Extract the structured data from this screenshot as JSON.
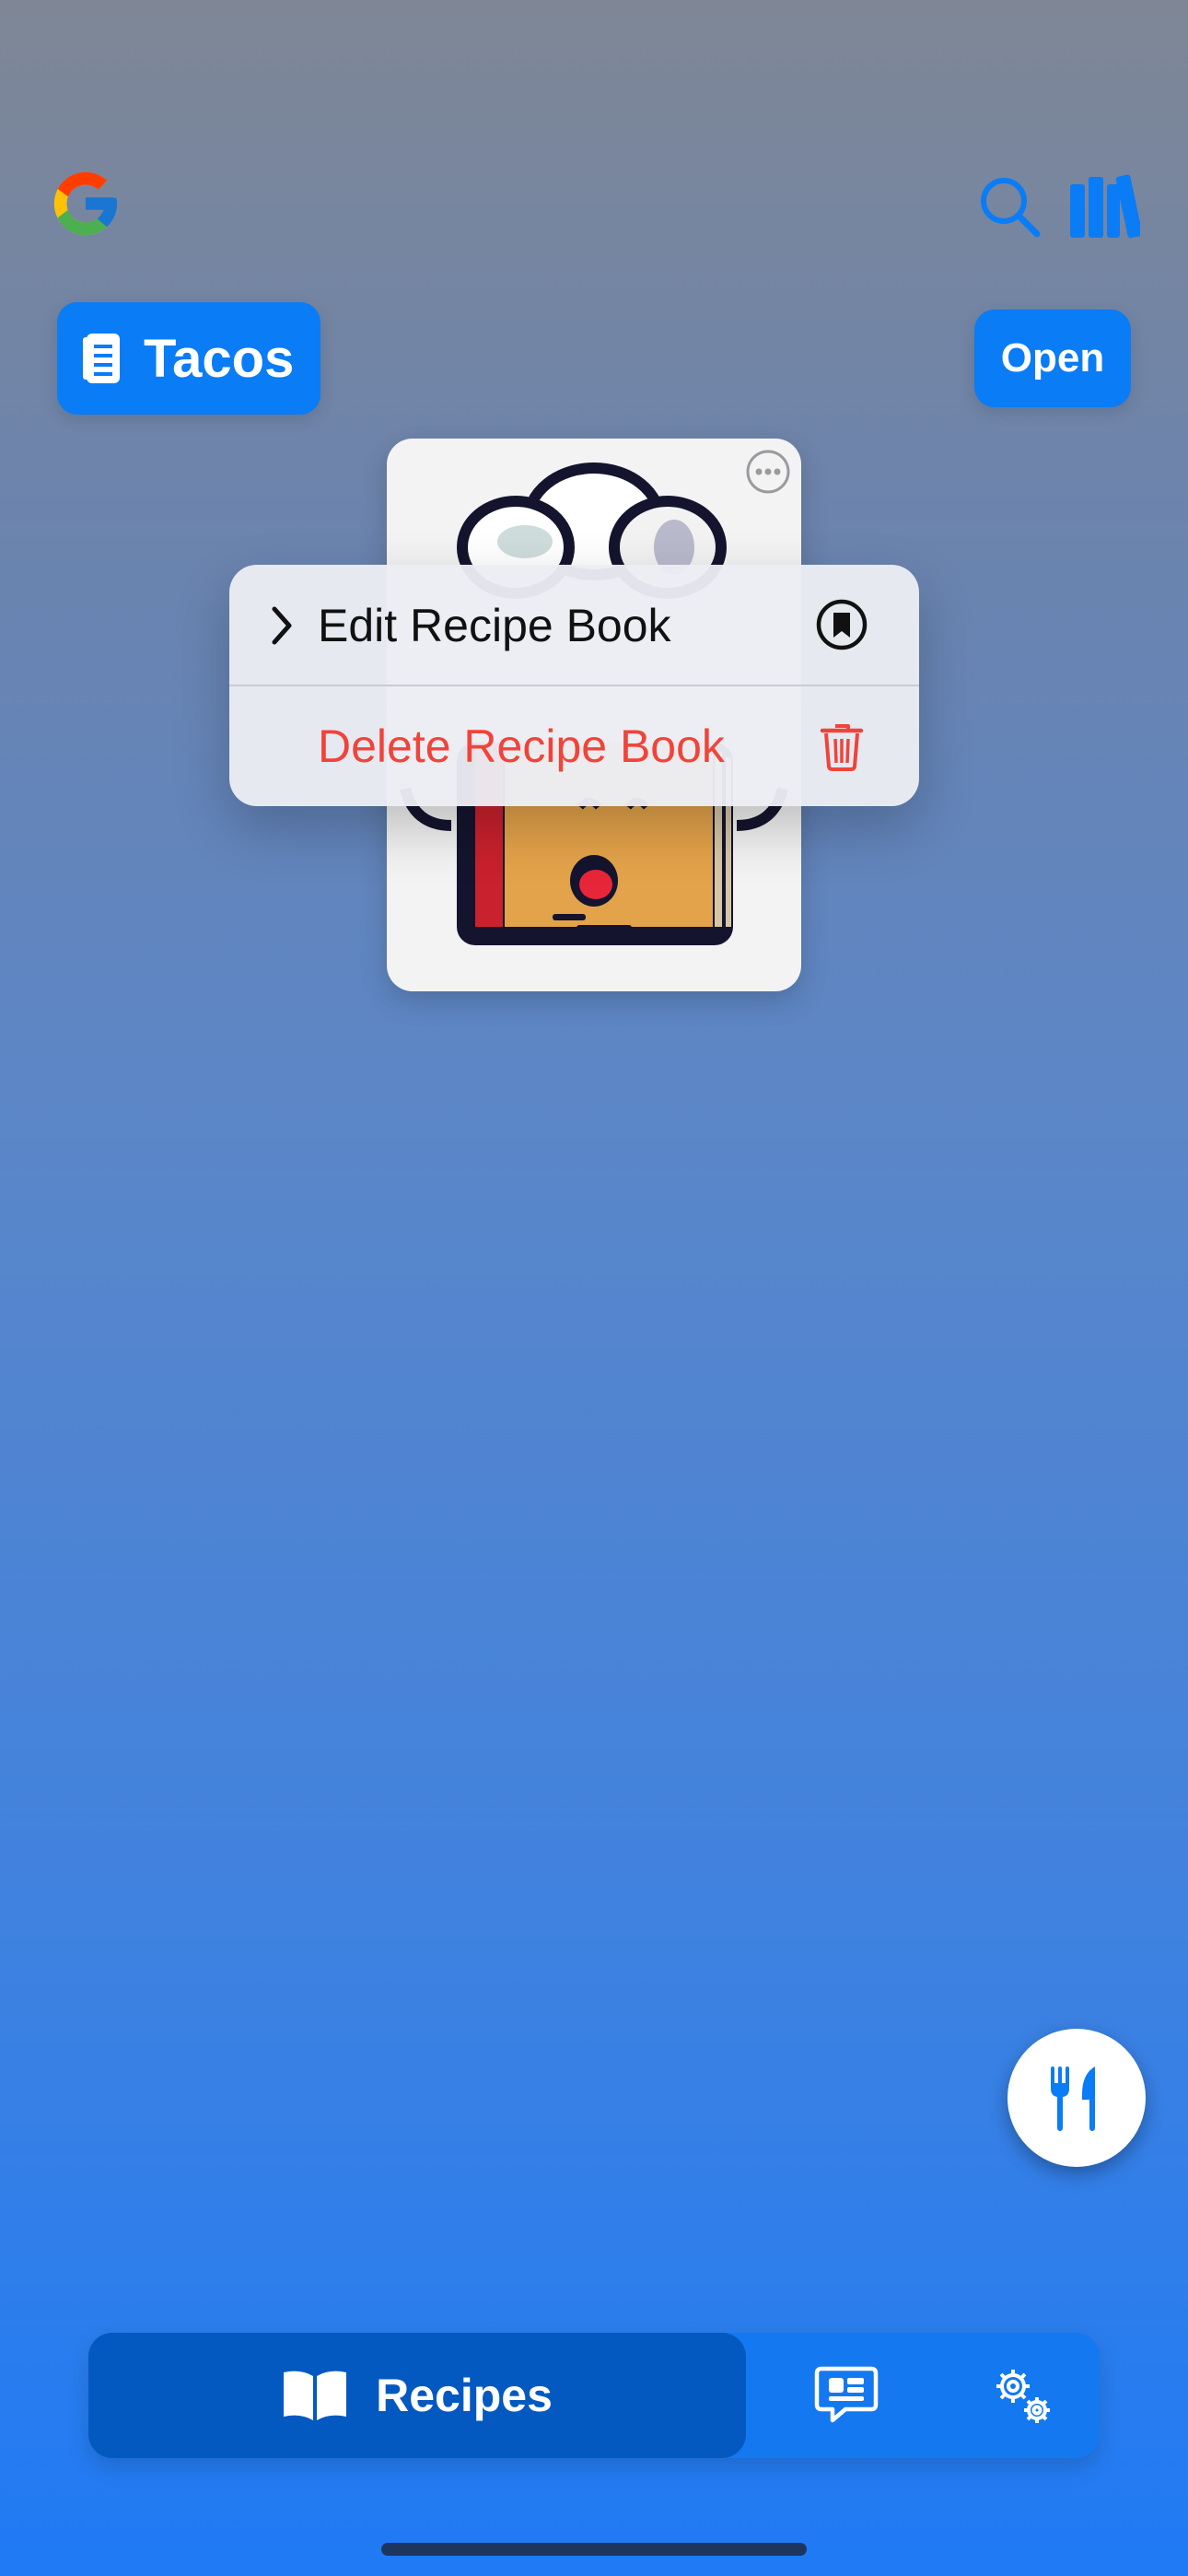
{
  "header": {
    "google_logo_icon": "google-g-icon",
    "search_icon": "search-icon",
    "library_icon": "library-books-icon"
  },
  "book_pill": {
    "label": "Tacos",
    "icon": "document-icon"
  },
  "open_button": {
    "label": "Open"
  },
  "context_menu": {
    "items": [
      {
        "label": "Edit Recipe Book",
        "icon": "bookmark-circle-icon",
        "leading": "chevron-right-icon",
        "color": "#111111"
      },
      {
        "label": "Delete Recipe Book",
        "icon": "trash-icon",
        "color": "#f0443a"
      }
    ]
  },
  "fab": {
    "icon": "fork-knife-icon"
  },
  "tabbar": {
    "tabs": [
      {
        "label": "Recipes",
        "icon": "open-book-icon",
        "selected": true
      },
      {
        "label": "",
        "icon": "chat-bubble-icon"
      },
      {
        "label": "",
        "icon": "gears-icon"
      }
    ]
  },
  "colors": {
    "accent": "#0a7cf5",
    "destructive": "#f0443a",
    "tab_selected": "#0459c0"
  }
}
